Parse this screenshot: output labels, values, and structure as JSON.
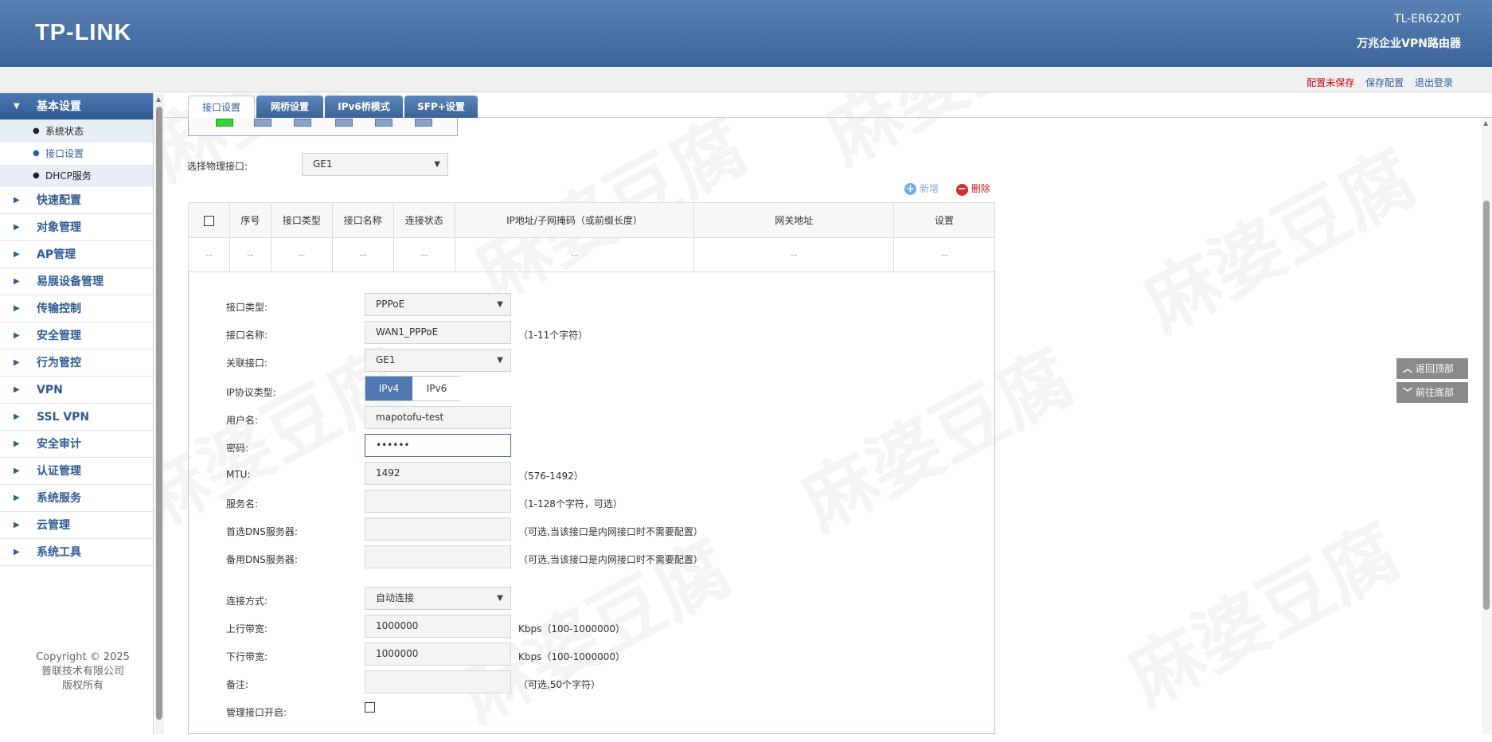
{
  "header": {
    "logo": "TP-LINK",
    "model": "TL-ER6220T",
    "subtitle": "万兆企业VPN路由器"
  },
  "status_links": {
    "unsaved": "配置未保存",
    "save": "保存配置",
    "logout": "退出登录"
  },
  "sidebar": {
    "groups": [
      {
        "label": "基本设置",
        "expanded": true,
        "subs": [
          "系统状态",
          "接口设置",
          "DHCP服务"
        ]
      },
      {
        "label": "快速配置"
      },
      {
        "label": "对象管理"
      },
      {
        "label": "AP管理"
      },
      {
        "label": "易展设备管理"
      },
      {
        "label": "传输控制"
      },
      {
        "label": "安全管理"
      },
      {
        "label": "行为管控"
      },
      {
        "label": "VPN"
      },
      {
        "label": "SSL VPN"
      },
      {
        "label": "安全审计"
      },
      {
        "label": "认证管理"
      },
      {
        "label": "系统服务"
      },
      {
        "label": "云管理"
      },
      {
        "label": "系统工具"
      }
    ],
    "copyright": [
      "Copyright © 2025",
      "普联技术有限公司",
      "版权所有"
    ]
  },
  "tabs": [
    "接口设置",
    "网桥设置",
    "IPv6桥模式",
    "SFP+设置"
  ],
  "port_select": {
    "label": "选择物理接口:",
    "value": "GE1"
  },
  "actions": {
    "add": "新增",
    "delete": "删除"
  },
  "table": {
    "headers": [
      "序号",
      "接口类型",
      "接口名称",
      "连接状态",
      "IP地址/子网掩码（或前缀长度）",
      "网关地址",
      "设置"
    ],
    "row": [
      "--",
      "--",
      "--",
      "--",
      "--",
      "--",
      "--",
      "--"
    ]
  },
  "form": {
    "iface_type": {
      "label": "接口类型:",
      "value": "PPPoE"
    },
    "iface_name": {
      "label": "接口名称:",
      "value": "WAN1_PPPoE",
      "hint": "（1-11个字符）"
    },
    "bind_iface": {
      "label": "关联接口:",
      "value": "GE1"
    },
    "ip_proto": {
      "label": "IP协议类型:",
      "options": [
        "IPv4",
        "IPv6"
      ]
    },
    "username": {
      "label": "用户名:",
      "value": "mapotofu-test"
    },
    "password": {
      "label": "密码:",
      "value": "••••••"
    },
    "mtu": {
      "label": "MTU:",
      "value": "1492",
      "hint": "（576-1492）"
    },
    "service": {
      "label": "服务名:",
      "value": "",
      "hint": "（1-128个字符，可选）"
    },
    "dns1": {
      "label": "首选DNS服务器:",
      "value": "",
      "hint": "（可选,当该接口是内网接口时不需要配置）"
    },
    "dns2": {
      "label": "备用DNS服务器:",
      "value": "",
      "hint": "（可选,当该接口是内网接口时不需要配置）"
    },
    "conn_mode": {
      "label": "连接方式:",
      "value": "自动连接"
    },
    "up_bw": {
      "label": "上行带宽:",
      "value": "1000000",
      "hint": "Kbps（100-1000000）"
    },
    "down_bw": {
      "label": "下行带宽:",
      "value": "1000000",
      "hint": "Kbps（100-1000000）"
    },
    "remark": {
      "label": "备注:",
      "value": "",
      "hint": "（可选,50个字符）"
    },
    "mgmt": {
      "label": "管理接口开启:"
    }
  },
  "float_buttons": {
    "top": "返回顶部",
    "bottom": "前往底部"
  },
  "watermark": "麻婆豆腐",
  "colors": {
    "header": "#3a6497",
    "accent": "#2f5b95",
    "unsaved": "#d40000"
  }
}
